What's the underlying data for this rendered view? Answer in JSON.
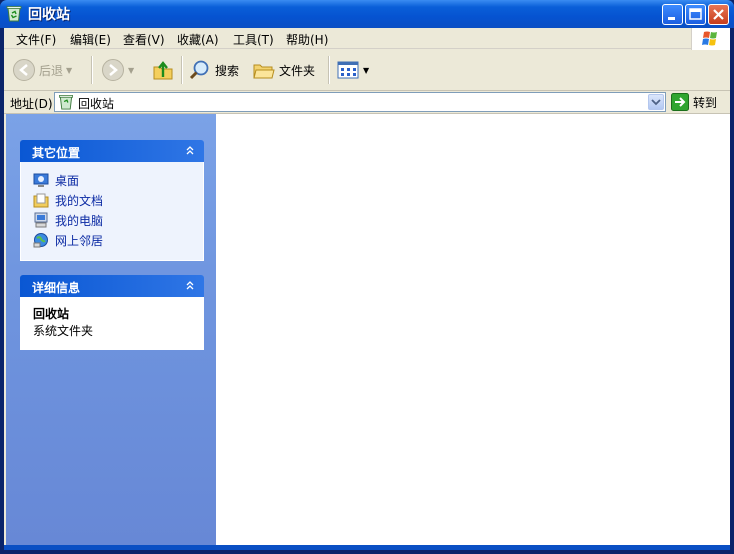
{
  "window": {
    "title": "回收站"
  },
  "menu": {
    "items": [
      "文件(F)",
      "编辑(E)",
      "查看(V)",
      "收藏(A)",
      "工具(T)",
      "帮助(H)"
    ]
  },
  "toolbar": {
    "back_label": "后退",
    "search_label": "搜索",
    "folders_label": "文件夹"
  },
  "address": {
    "label": "地址(D)",
    "value": "回收站",
    "go_label": "转到"
  },
  "sidebar": {
    "other_places": {
      "title": "其它位置",
      "items": [
        "桌面",
        "我的文档",
        "我的电脑",
        "网上邻居"
      ]
    },
    "details": {
      "title": "详细信息",
      "name": "回收站",
      "type": "系统文件夹"
    }
  },
  "icons": {
    "title": "recycle-bin-icon",
    "back": "back-arrow-icon",
    "forward": "forward-arrow-icon",
    "up": "folder-up-icon",
    "search": "magnifier-icon",
    "folders": "folders-icon",
    "views": "views-icon",
    "go": "go-arrow-icon",
    "desktop": "desktop-icon",
    "documents": "my-documents-icon",
    "computer": "my-computer-icon",
    "network": "network-places-icon"
  },
  "colors": {
    "titlebar": "#0653d1",
    "sidebar": "#6f95df",
    "link": "#0c2ba4"
  }
}
